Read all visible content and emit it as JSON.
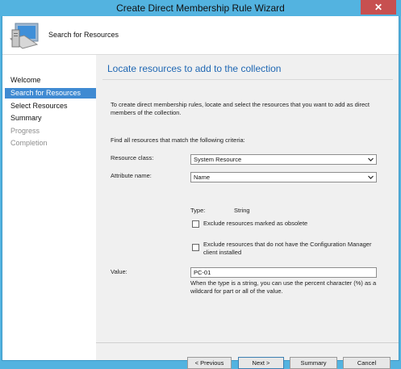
{
  "window": {
    "title": "Create Direct Membership Rule Wizard",
    "close_label": "✕"
  },
  "header": {
    "label": "Search for Resources",
    "icon": "computer-icon"
  },
  "nav": {
    "items": [
      {
        "label": "Welcome",
        "state": "normal"
      },
      {
        "label": "Search for Resources",
        "state": "active"
      },
      {
        "label": "Select Resources",
        "state": "normal"
      },
      {
        "label": "Summary",
        "state": "normal"
      },
      {
        "label": "Progress",
        "state": "disabled"
      },
      {
        "label": "Completion",
        "state": "disabled"
      }
    ]
  },
  "main": {
    "title": "Locate resources to add to the collection",
    "intro": "To create direct membership rules, locate and select the resources that you want to add as direct members of the collection.",
    "criteria": "Find all resources that match the following criteria:",
    "resource_class_label": "Resource class:",
    "resource_class_value": "System Resource",
    "attribute_name_label": "Attribute name:",
    "attribute_name_value": "Name",
    "type_label": "Type:",
    "type_value": "String",
    "exclude_obsolete_label": "Exclude resources marked as obsolete",
    "exclude_no_client_label": "Exclude resources that do not have the Configuration Manager client installed",
    "value_label": "Value:",
    "value": "PC-01",
    "hint": "When the type is a string, you can use the percent character (%) as a wildcard for part or all of the value."
  },
  "buttons": {
    "previous": "< Previous",
    "next": "Next >",
    "summary": "Summary",
    "cancel": "Cancel"
  }
}
